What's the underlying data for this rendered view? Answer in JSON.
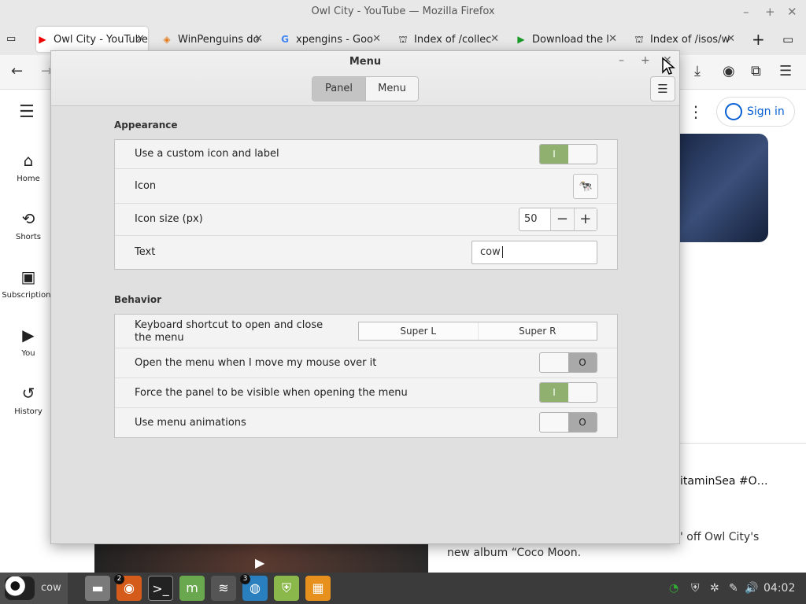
{
  "firefox": {
    "window_title": "Owl City - YouTube — Mozilla Firefox",
    "tabs": [
      {
        "label": "Owl City - YouTube",
        "icon": "youtube-icon",
        "active": true
      },
      {
        "label": "WinPenguins do",
        "icon": "winpenguins-icon",
        "active": false
      },
      {
        "label": "xpengins - Goo",
        "icon": "google-icon",
        "active": false
      },
      {
        "label": "Index of /collec",
        "icon": "archive-icon",
        "active": false
      },
      {
        "label": "Download the l",
        "icon": "play-icon",
        "active": false
      },
      {
        "label": "Index of /isos/w",
        "icon": "archive-icon",
        "active": false
      }
    ]
  },
  "youtube": {
    "sidebar": [
      {
        "label": "Home",
        "icon": "home-icon"
      },
      {
        "label": "Shorts",
        "icon": "shorts-icon"
      },
      {
        "label": "Subscriptions",
        "icon": "subscriptions-icon"
      },
      {
        "label": "You",
        "icon": "you-icon"
      },
      {
        "label": "History",
        "icon": "history-icon"
      }
    ],
    "sign_in": "Sign in",
    "text1": "itaminSea #O…",
    "text2": "' off Owl City's",
    "text3": "new album “Coco Moon."
  },
  "dialog": {
    "title": "Menu",
    "tabs": [
      {
        "label": "Panel",
        "selected": true
      },
      {
        "label": "Menu",
        "selected": false
      }
    ],
    "appearance": {
      "heading": "Appearance",
      "custom_icon_label": "Use a custom icon and label",
      "custom_icon_on": true,
      "icon_label": "Icon",
      "icon_size_label": "Icon size (px)",
      "icon_size_value": "50",
      "text_label": "Text",
      "text_value": "cow"
    },
    "behavior": {
      "heading": "Behavior",
      "shortcut_label": "Keyboard shortcut to open and close the menu",
      "shortcut_1": "Super L",
      "shortcut_2": "Super R",
      "hover_label": "Open the menu when I move my mouse over it",
      "hover_on": false,
      "force_panel_label": "Force the panel to be visible when opening the menu",
      "force_panel_on": true,
      "animations_label": "Use menu animations",
      "animations_on": false
    }
  },
  "taskbar": {
    "menu_label": "cow",
    "apps": [
      {
        "name": "files-icon",
        "badge": ""
      },
      {
        "name": "firefox-icon",
        "badge": "2"
      },
      {
        "name": "terminal-icon",
        "badge": ""
      },
      {
        "name": "mint-icon",
        "badge": ""
      },
      {
        "name": "waves-icon",
        "badge": ""
      },
      {
        "name": "globe-icon",
        "badge": "3"
      },
      {
        "name": "shield-update-icon",
        "badge": ""
      },
      {
        "name": "orange-app-icon",
        "badge": ""
      }
    ],
    "clock": "04:02"
  }
}
